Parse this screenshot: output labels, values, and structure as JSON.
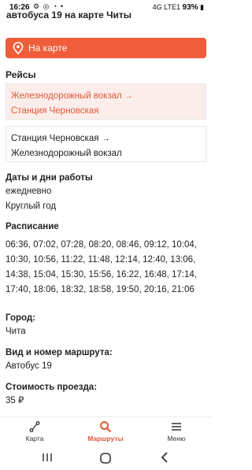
{
  "status_bar": {
    "time": "16:26",
    "icons": "⚙ ◎ ◔ •",
    "signal": "4G LTE1",
    "battery": "93%"
  },
  "page": {
    "title": "автобуса 19 на карте Читы"
  },
  "map_button": {
    "label": "На карте"
  },
  "routes": {
    "title": "Рейсы",
    "items": [
      {
        "from": "Железнодорожный вокзал",
        "arrow": "→",
        "to": "Станция Черновская",
        "active": true
      },
      {
        "from": "Станция Черновская",
        "arrow": "→",
        "to": "Железнодорожный вокзал",
        "active": false
      }
    ]
  },
  "dates": {
    "title": "Даты и дни работы",
    "line1": "ежедневно",
    "line2": "Круглый год"
  },
  "schedule": {
    "title": "Расписание",
    "times": "06:36, 07:02, 07:28, 08:20, 08:46, 09:12, 10:04, 10:30, 10:56, 11:22, 11:48, 12:14, 12:40, 13:06, 14:38, 15:04, 15:30, 15:56, 16:22, 16:48, 17:14, 17:40, 18:06, 18:32, 18:58, 19:50, 20:16, 21:06"
  },
  "city": {
    "label": "Город:",
    "value": "Чита"
  },
  "route_type": {
    "label": "Вид и номер маршрута:",
    "value": "Автобус 19"
  },
  "fare": {
    "label": "Стоимость проезда:",
    "value": "35 ₽"
  },
  "bottom_nav": {
    "items": [
      {
        "label": "Карта",
        "icon": "route-icon",
        "active": false
      },
      {
        "label": "Маршруты",
        "icon": "search-icon",
        "active": true
      },
      {
        "label": "Меню",
        "icon": "menu-icon",
        "active": false
      }
    ]
  },
  "colors": {
    "accent": "#f05d3a",
    "accent_text": "#e0583b",
    "active_card_bg": "#fbeeea"
  }
}
